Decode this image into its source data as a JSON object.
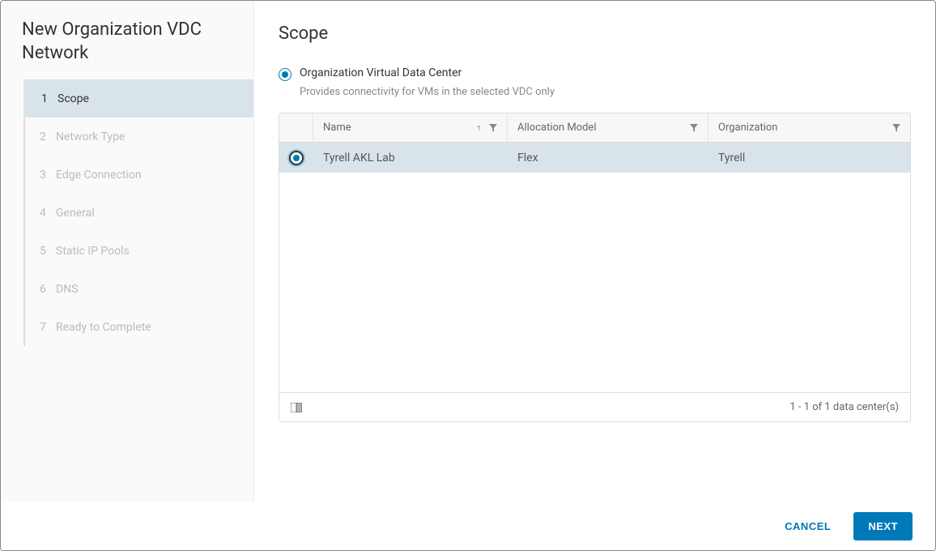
{
  "wizard": {
    "title": "New Organization VDC Network",
    "steps": [
      {
        "num": "1",
        "label": "Scope",
        "active": true
      },
      {
        "num": "2",
        "label": "Network Type",
        "active": false
      },
      {
        "num": "3",
        "label": "Edge Connection",
        "active": false
      },
      {
        "num": "4",
        "label": "General",
        "active": false
      },
      {
        "num": "5",
        "label": "Static IP Pools",
        "active": false
      },
      {
        "num": "6",
        "label": "DNS",
        "active": false
      },
      {
        "num": "7",
        "label": "Ready to Complete",
        "active": false
      }
    ]
  },
  "page": {
    "title": "Scope",
    "scope_option": {
      "label": "Organization Virtual Data Center",
      "description": "Provides connectivity for VMs in the selected VDC only",
      "selected": true
    }
  },
  "table": {
    "columns": {
      "name": "Name",
      "allocation_model": "Allocation Model",
      "organization": "Organization"
    },
    "rows": [
      {
        "name": "Tyrell AKL Lab",
        "allocation_model": "Flex",
        "organization": "Tyrell",
        "selected": true
      }
    ],
    "footer_text": "1 - 1 of 1 data center(s)"
  },
  "buttons": {
    "cancel": "CANCEL",
    "next": "NEXT"
  }
}
